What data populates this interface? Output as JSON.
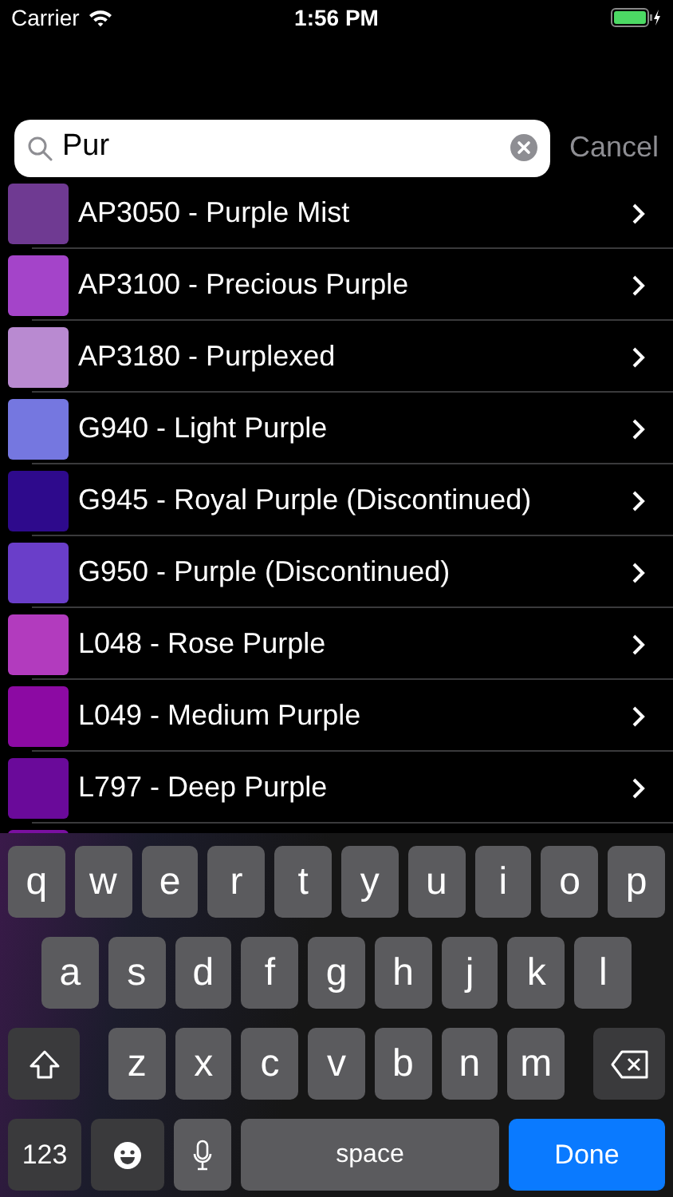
{
  "status_bar": {
    "carrier": "Carrier",
    "time": "1:56 PM"
  },
  "search": {
    "value": "Pur",
    "cancel": "Cancel"
  },
  "results": [
    {
      "label": "AP3050 - Purple Mist",
      "color": "#6f3a92"
    },
    {
      "label": "AP3100 - Precious Purple",
      "color": "#a444c9"
    },
    {
      "label": "AP3180 - Purplexed",
      "color": "#b98ad1"
    },
    {
      "label": "G940 - Light Purple",
      "color": "#7577e0"
    },
    {
      "label": "G945 - Royal Purple (Discontinued)",
      "color": "#2e0a8c"
    },
    {
      "label": "G950 - Purple (Discontinued)",
      "color": "#6a3ec9"
    },
    {
      "label": "L048 - Rose Purple",
      "color": "#b23bbe"
    },
    {
      "label": "L049 - Medium Purple",
      "color": "#8c0aa3"
    },
    {
      "label": "L797 - Deep Purple",
      "color": "#6a0a9a"
    },
    {
      "color": "#7a10a0"
    }
  ],
  "keyboard": {
    "rows": [
      [
        "q",
        "w",
        "e",
        "r",
        "t",
        "y",
        "u",
        "i",
        "o",
        "p"
      ],
      [
        "a",
        "s",
        "d",
        "f",
        "g",
        "h",
        "j",
        "k",
        "l"
      ],
      [
        "z",
        "x",
        "c",
        "v",
        "b",
        "n",
        "m"
      ]
    ],
    "numbers": "123",
    "space": "space",
    "done": "Done"
  }
}
